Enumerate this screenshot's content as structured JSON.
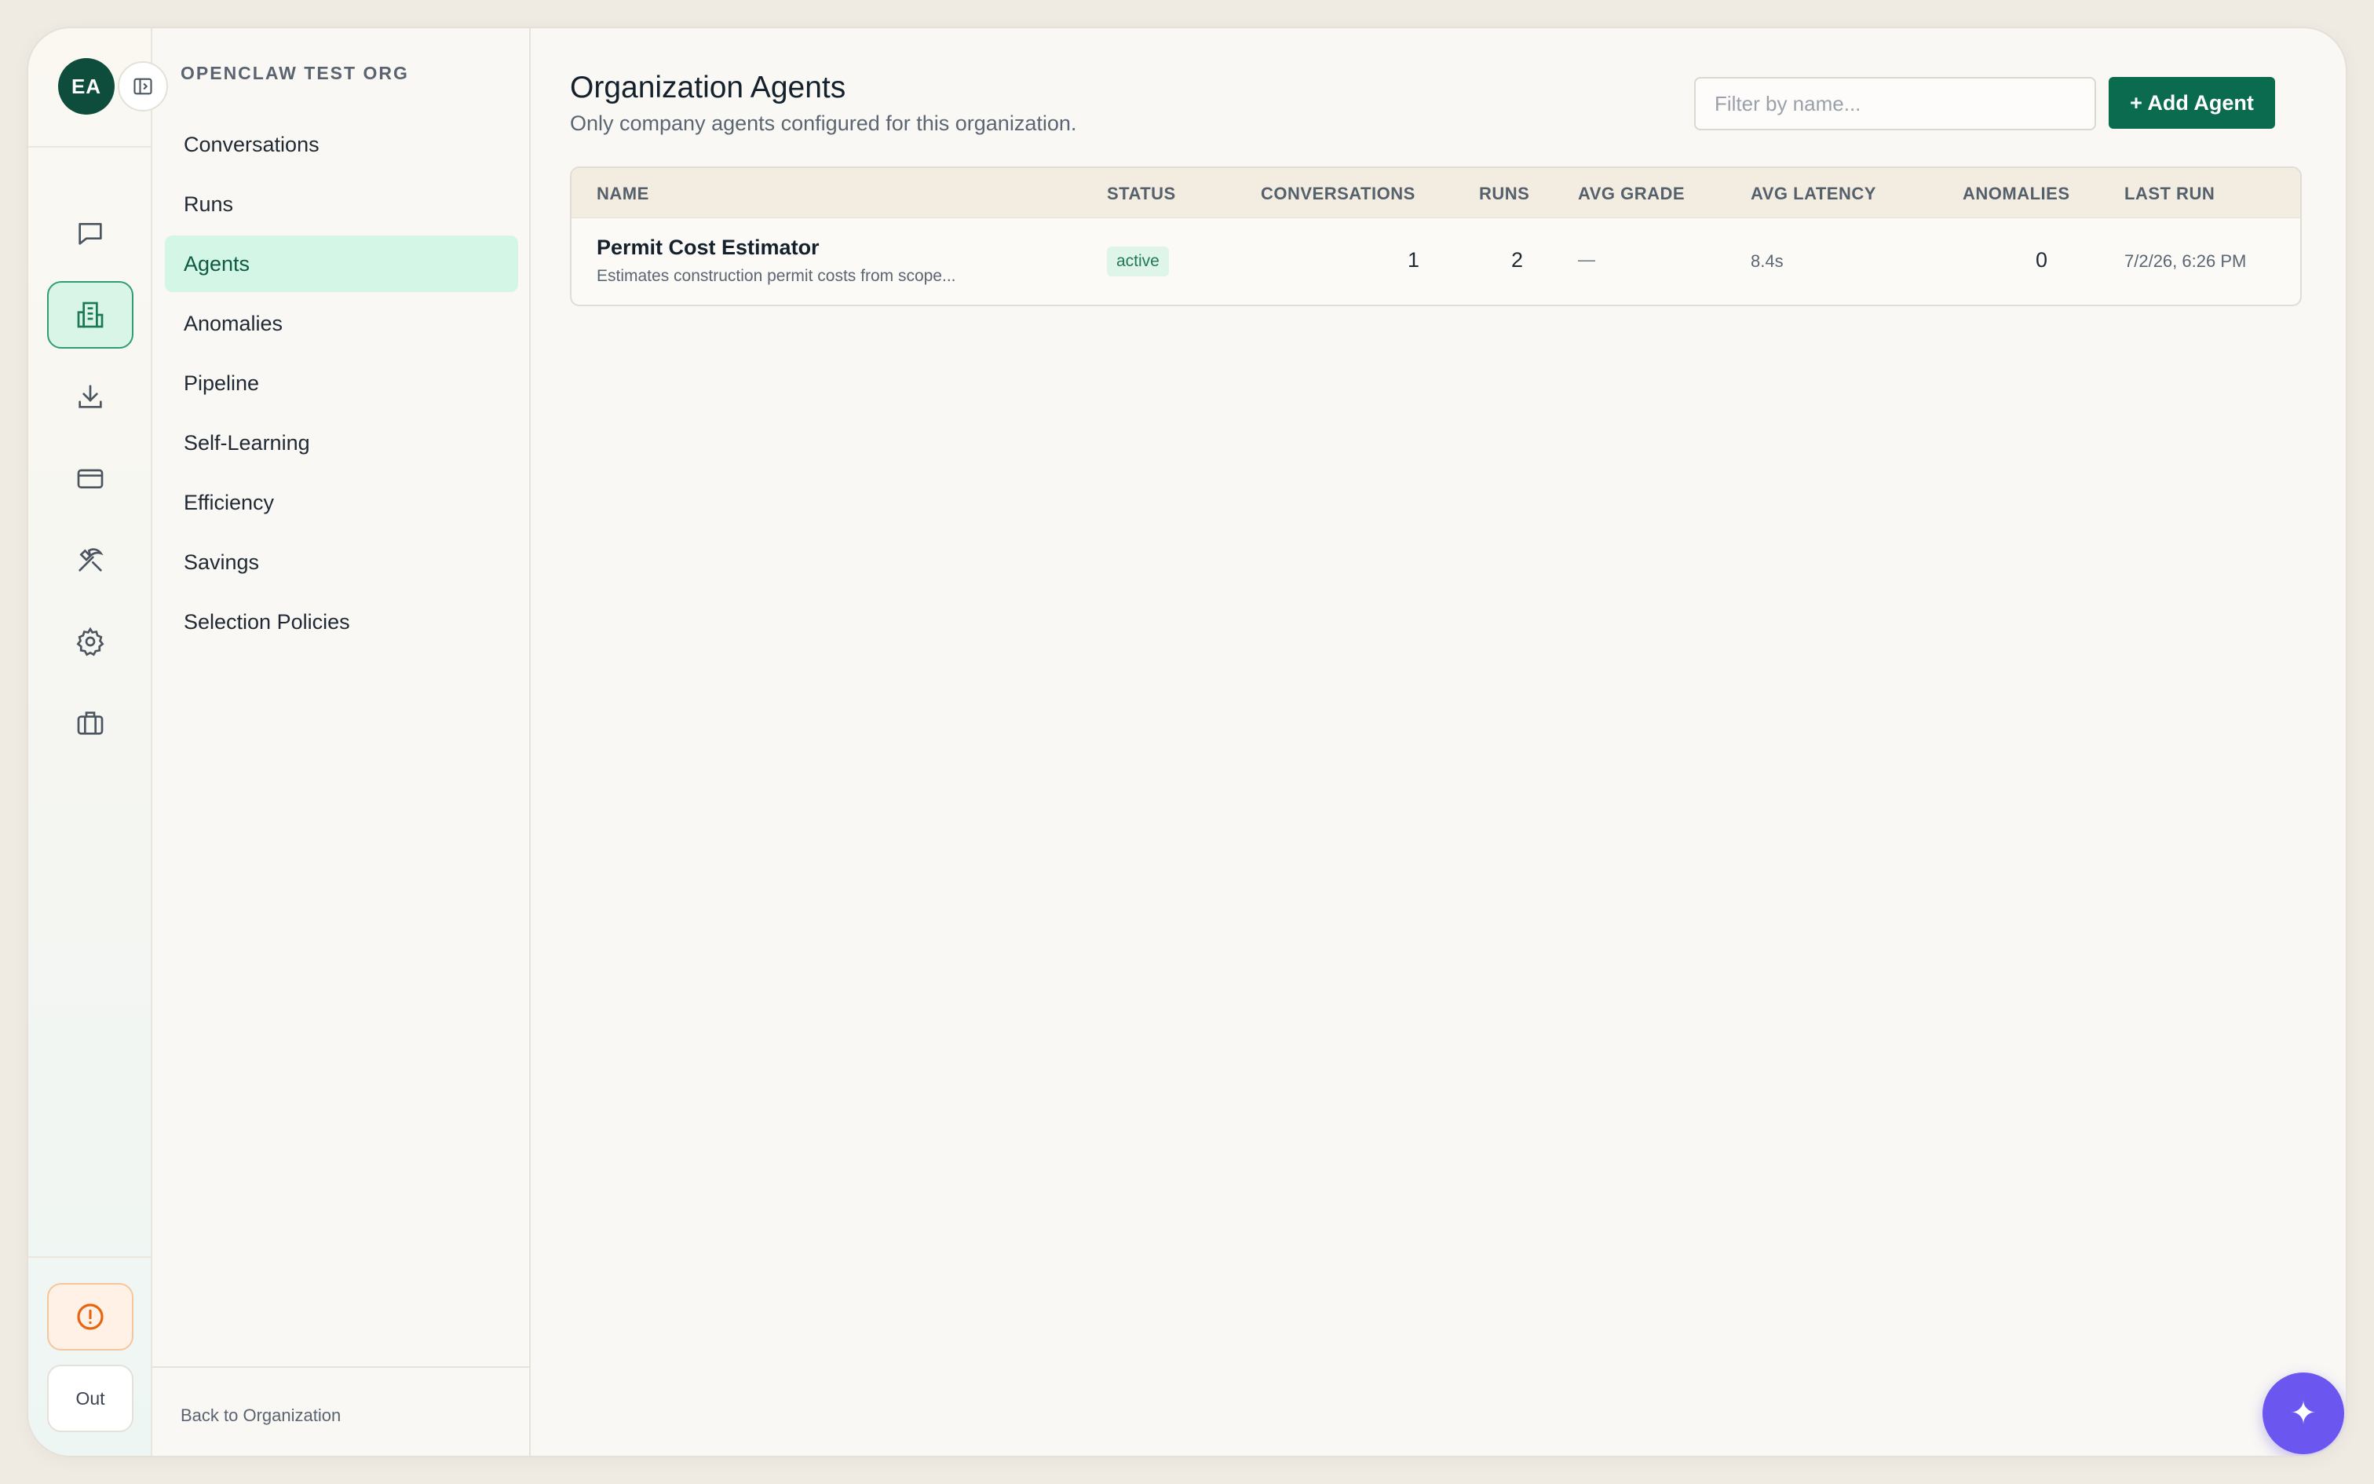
{
  "user": {
    "initials": "EA"
  },
  "org": {
    "name": "OPENCLAW TEST ORG"
  },
  "rail": {
    "items": [
      {
        "icon": "chat-icon",
        "active": false
      },
      {
        "icon": "building-icon",
        "active": true
      },
      {
        "icon": "download-icon",
        "active": false
      },
      {
        "icon": "credit-card-icon",
        "active": false
      },
      {
        "icon": "tools-icon",
        "active": false
      },
      {
        "icon": "gear-icon",
        "active": false
      },
      {
        "icon": "briefcase-icon",
        "active": false
      }
    ],
    "out_label": "Out"
  },
  "nav": {
    "items": [
      {
        "label": "Conversations",
        "active": false
      },
      {
        "label": "Runs",
        "active": false
      },
      {
        "label": "Agents",
        "active": true
      },
      {
        "label": "Anomalies",
        "active": false
      },
      {
        "label": "Pipeline",
        "active": false
      },
      {
        "label": "Self-Learning",
        "active": false
      },
      {
        "label": "Efficiency",
        "active": false
      },
      {
        "label": "Savings",
        "active": false
      },
      {
        "label": "Selection Policies",
        "active": false
      }
    ],
    "back_label": "Back to Organization"
  },
  "page": {
    "title": "Organization Agents",
    "subtitle": "Only company agents configured for this organization.",
    "filter_placeholder": "Filter by name...",
    "add_button": "+ Add Agent"
  },
  "table": {
    "headers": {
      "name": "NAME",
      "status": "STATUS",
      "conversations": "CONVERSATIONS",
      "runs": "RUNS",
      "avg_grade": "AVG GRADE",
      "avg_latency": "AVG LATENCY",
      "anomalies": "ANOMALIES",
      "last_run": "LAST RUN"
    },
    "rows": [
      {
        "name": "Permit Cost Estimator",
        "description": "Estimates construction permit costs from scope...",
        "status": "active",
        "conversations": "1",
        "runs": "2",
        "avg_grade": "—",
        "avg_latency": "8.4s",
        "anomalies": "0",
        "last_run": "7/2/26, 6:26 PM"
      }
    ]
  },
  "fab": {
    "icon": "sparkle-icon",
    "glyph": "✦"
  },
  "colors": {
    "accent": "#0b6b4f",
    "fab": "#6b57f0",
    "active_nav": "#d3f6e6"
  }
}
